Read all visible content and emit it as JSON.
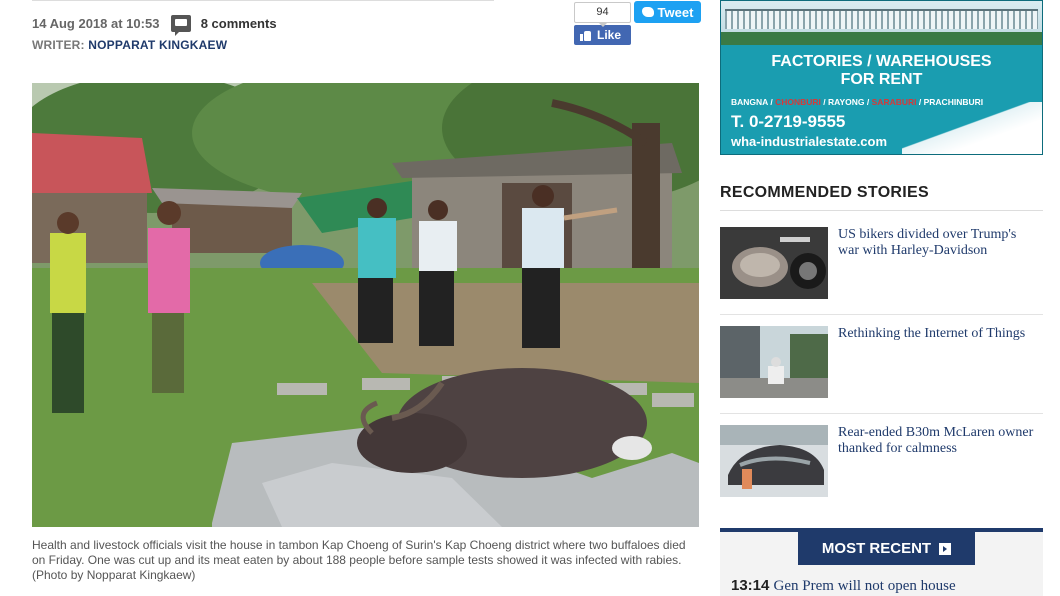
{
  "article": {
    "date": "14 Aug 2018 at 10:53",
    "comments": "8 comments",
    "writer_label": "WRITER:",
    "writer_name": "NOPPARAT KINGKAEW",
    "caption": "Health and livestock officials visit the house in tambon Kap Choeng of Surin's Kap Choeng district where two buffaloes died on Friday. One was cut up and its meat eaten by about 188 people before sample tests showed it was infected with rabies.(Photo by Nopparat Kingkaew)"
  },
  "share": {
    "like_count": "94",
    "like_label": "Like",
    "tweet_label": "Tweet",
    "facebook_color": "#4267b2",
    "twitter_color": "#1da1f2"
  },
  "ad": {
    "title_line1": "FACTORIES / WAREHOUSES",
    "title_line2": "FOR RENT",
    "loc_1": "BANGNA /",
    "loc_2": "CHONBURI",
    "loc_3": "/ RAYONG /",
    "loc_4": "SARABURI",
    "loc_5": "/ PRACHINBURI",
    "phone": "T. 0-2719-9555",
    "website": "wha-industrialestate.com",
    "brand_color": "#1a9db0"
  },
  "recommended": {
    "heading": "RECOMMENDED STORIES",
    "items": [
      {
        "title": "US bikers divided over Trump's war with Harley-Davidson",
        "icon": "motorcycle-photo"
      },
      {
        "title": "Rethinking the Internet of Things",
        "icon": "city-street-photo"
      },
      {
        "title": "Rear-ended B30m McLaren owner thanked for calmness",
        "icon": "sports-car-photo"
      }
    ]
  },
  "most_recent": {
    "label": "MOST RECENT",
    "items": [
      {
        "time": "13:14",
        "headline": "Gen Prem will not open house"
      }
    ]
  },
  "colors": {
    "navy": "#1f3a6b",
    "link": "#1f3a6b"
  }
}
